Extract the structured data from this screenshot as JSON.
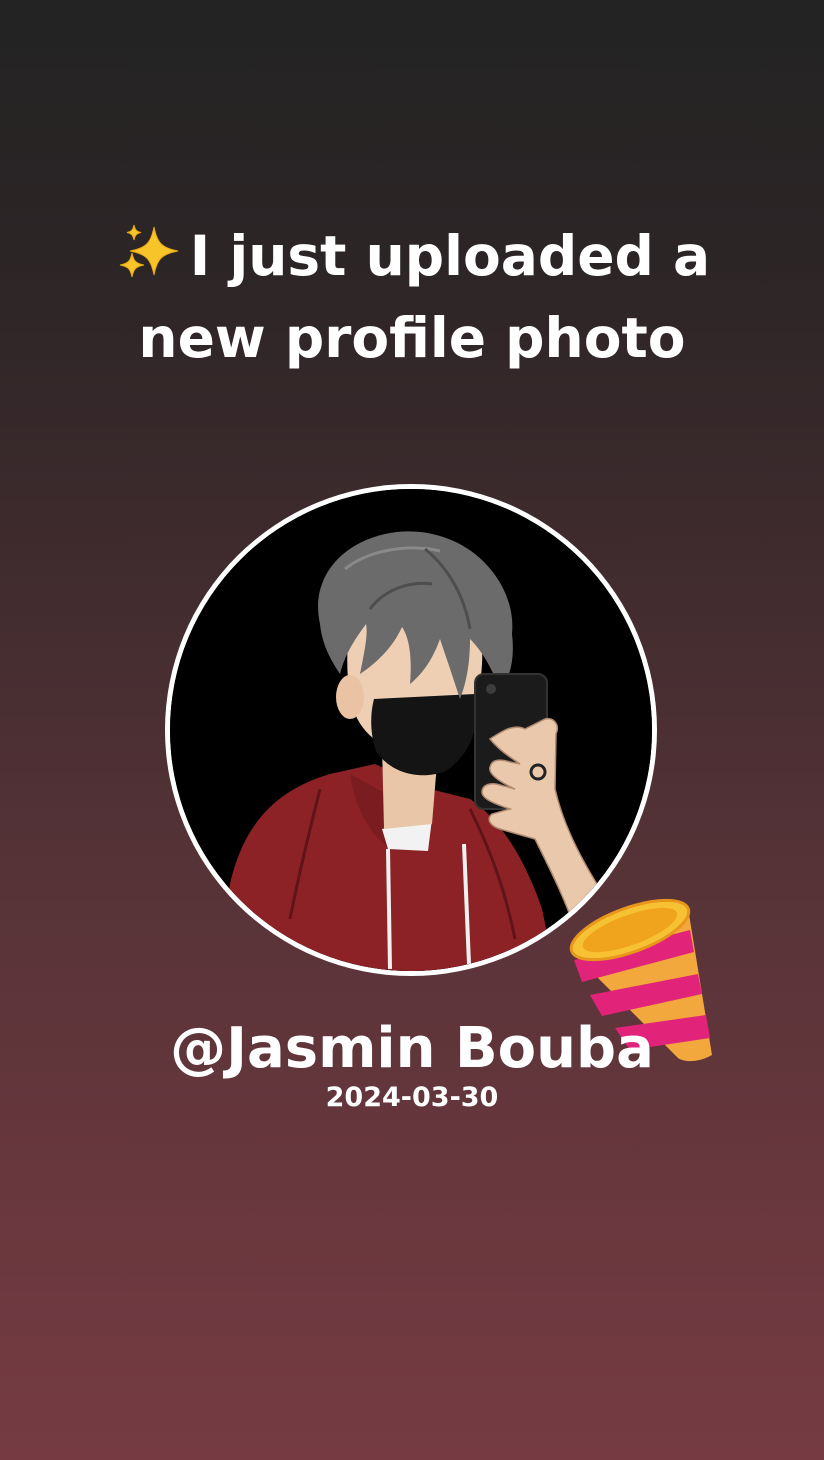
{
  "announcement": {
    "emoji_icon": "sparkles-icon",
    "line1": "I just uploaded a",
    "line2": "new profile photo"
  },
  "profile": {
    "username": "@Jasmin Bouba",
    "date": "2024-03-30",
    "avatar_description_icon": "profile-photo"
  },
  "decoration": {
    "icon": "party-popper-icon"
  },
  "colors": {
    "background_top": "#232323",
    "background_bottom": "#763b42",
    "text": "#ffffff",
    "ring": "#ffffff"
  }
}
